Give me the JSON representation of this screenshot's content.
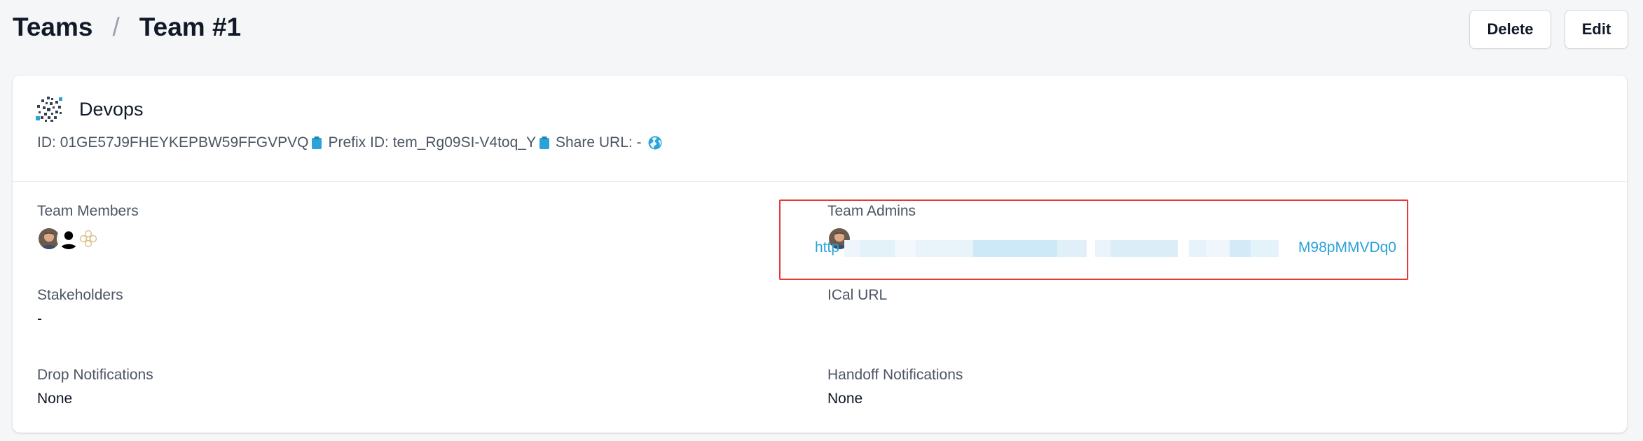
{
  "header": {
    "breadcrumb_root": "Teams",
    "breadcrumb_sep": "/",
    "breadcrumb_current": "Team #1",
    "delete_label": "Delete",
    "edit_label": "Edit"
  },
  "team": {
    "name": "Devops",
    "id_label": "ID:",
    "id_value": "01GE57J9FHEYKEPBW59FFGVPVQ",
    "prefix_label": "Prefix ID:",
    "prefix_value": "tem_Rg09SI-V4toq_Y",
    "share_label": "Share URL:",
    "share_value": "-"
  },
  "fields": {
    "members_label": "Team Members",
    "admins_label": "Team Admins",
    "stakeholders_label": "Stakeholders",
    "stakeholders_value": "-",
    "ical_label": "ICal URL",
    "ical_visible_start": "http",
    "ical_visible_end": "M98pMMVDq0",
    "drop_label": "Drop Notifications",
    "drop_value": "None",
    "handoff_label": "Handoff Notifications",
    "handoff_value": "None"
  },
  "colors": {
    "accent": "#2aa3d9",
    "highlight_border": "#e53935",
    "background": "#f5f6f8"
  },
  "icons": {
    "team_logo": "team-logo-icon",
    "copy": "clipboard-icon",
    "share": "globe-icon"
  }
}
